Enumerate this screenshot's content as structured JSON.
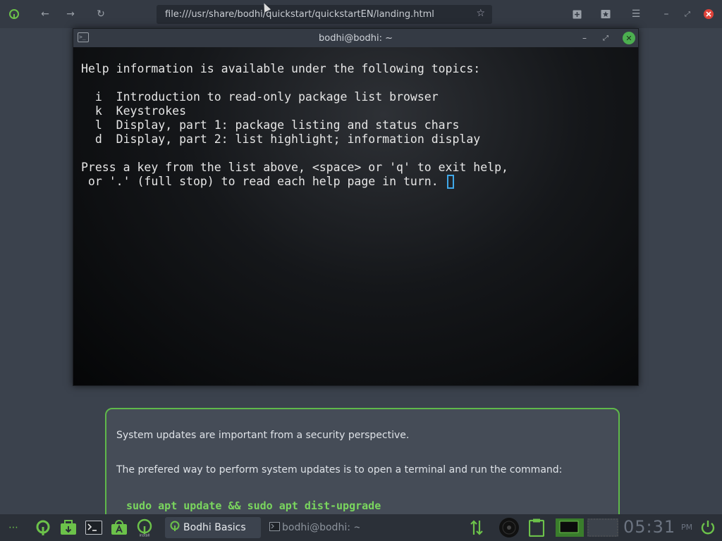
{
  "browser": {
    "url": "file:///usr/share/bodhi/quickstart/quickstartEN/landing.html",
    "icons": [
      "bodhi-logo-icon",
      "back-icon",
      "forward-icon",
      "reload-icon",
      "bookmark-star-icon",
      "new-tab-icon",
      "bookmarks-icon",
      "menu-icon",
      "minimize-icon",
      "restore-icon",
      "close-icon"
    ]
  },
  "terminal": {
    "title": "bodhi@bodhi: ~",
    "lines": [
      "Help information is available under the following topics:",
      "",
      "  i  Introduction to read-only package list browser",
      "  k  Keystrokes",
      "  l  Display, part 1: package listing and status chars",
      "  d  Display, part 2: list highlight; information display",
      "",
      "Press a key from the list above, <space> or 'q' to exit help,",
      " or '.' (full stop) to read each help page in turn. "
    ]
  },
  "info_card": {
    "line1": "System updates are important from a security perspective.",
    "line2": "The prefered way to perform system updates is to open a terminal and run the command:",
    "command": "sudo apt update && sudo apt dist-upgrade"
  },
  "taskbar": {
    "tasks": [
      {
        "label": "Bodhi Basics",
        "active": true
      },
      {
        "label": "bodhi@bodhi: ~",
        "active": false
      }
    ],
    "clock": "05:31",
    "ampm": "PM",
    "accent": "#6cc24a"
  }
}
